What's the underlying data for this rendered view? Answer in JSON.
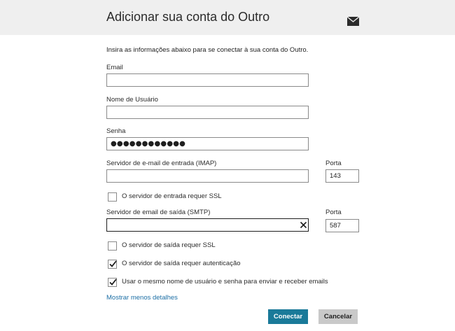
{
  "header": {
    "title": "Adicionar sua conta do Outro",
    "icon": "mail-icon"
  },
  "form": {
    "instructions": "Insira as informações abaixo para se conectar à sua conta do Outro.",
    "email": {
      "label": "Email",
      "value": ""
    },
    "username": {
      "label": "Nome de Usuário",
      "value": ""
    },
    "password": {
      "label": "Senha",
      "value": "●●●●●●●●●●●●"
    },
    "incoming_server": {
      "label": "Servidor de e-mail de entrada (IMAP)",
      "value": ""
    },
    "incoming_port": {
      "label": "Porta",
      "value": "143"
    },
    "incoming_ssl": {
      "label": "O servidor de entrada requer SSL",
      "checked": false
    },
    "outgoing_server": {
      "label": "Servidor de email de saída (SMTP)",
      "value": ""
    },
    "outgoing_port": {
      "label": "Porta",
      "value": "587"
    },
    "outgoing_ssl": {
      "label": "O servidor de saída requer SSL",
      "checked": false
    },
    "outgoing_auth": {
      "label": "O servidor de saída requer autenticação",
      "checked": true
    },
    "same_credentials": {
      "label": "Usar o mesmo nome de usuário e senha para enviar e receber emails",
      "checked": true
    },
    "details_link": "Mostrar menos detalhes"
  },
  "buttons": {
    "connect": "Conectar",
    "cancel": "Cancelar"
  },
  "colors": {
    "header_bg": "#efefef",
    "primary_button": "#1a7a99",
    "secondary_button": "#c9c9c9",
    "link": "#1d6fa5"
  }
}
